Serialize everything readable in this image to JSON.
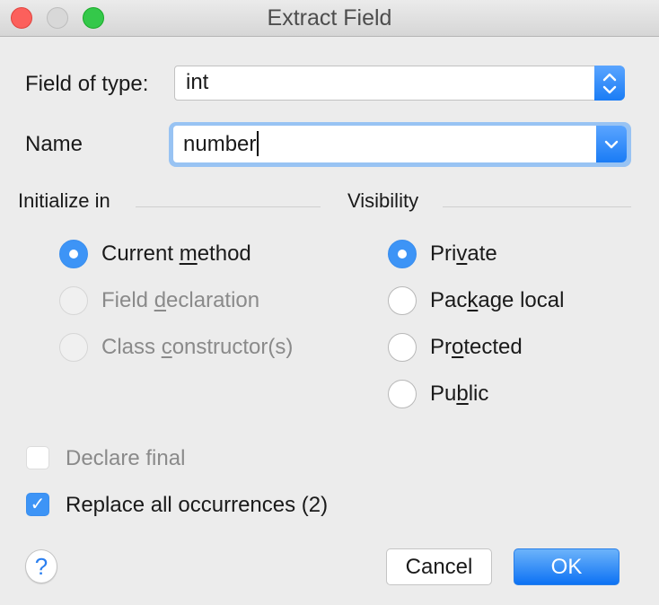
{
  "window": {
    "title": "Extract Field",
    "buttons": [
      "close",
      "minimize",
      "zoom"
    ]
  },
  "form": {
    "type_label": "Field of type:",
    "type_value": "int",
    "name_label": "Name",
    "name_value": "number"
  },
  "initialize_in": {
    "title": "Initialize in",
    "options": [
      {
        "pre": "Current ",
        "mnemonic": "m",
        "post": "ethod",
        "checked": true,
        "enabled": true
      },
      {
        "pre": "Field ",
        "mnemonic": "d",
        "post": "eclaration",
        "checked": false,
        "enabled": false
      },
      {
        "pre": "Class ",
        "mnemonic": "c",
        "post": "onstructor(s)",
        "checked": false,
        "enabled": false
      }
    ]
  },
  "visibility": {
    "title": "Visibility",
    "options": [
      {
        "pre": "Pri",
        "mnemonic": "v",
        "post": "ate",
        "checked": true
      },
      {
        "pre": "Pac",
        "mnemonic": "k",
        "post": "age local",
        "checked": false
      },
      {
        "pre": "Pr",
        "mnemonic": "o",
        "post": "tected",
        "checked": false
      },
      {
        "pre": "Pu",
        "mnemonic": "b",
        "post": "lic",
        "checked": false
      }
    ]
  },
  "checkboxes": {
    "declare_final": {
      "label": "Declare final",
      "checked": false,
      "enabled": false
    },
    "replace_all": {
      "label": "Replace all occurrences (2)",
      "checked": true,
      "enabled": true
    }
  },
  "footer": {
    "help_glyph": "?",
    "cancel_label": "Cancel",
    "ok_label": "OK"
  },
  "icons": {
    "stepper": "up-down-chevrons",
    "dropdown": "chevron-down",
    "check": "✓"
  }
}
